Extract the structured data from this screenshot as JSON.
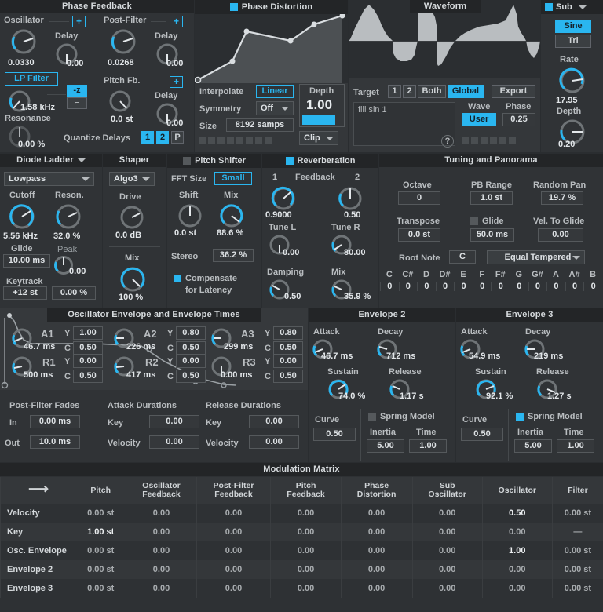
{
  "colors": {
    "accent": "#2ab6f0",
    "panel": "#303336",
    "header": "#232527",
    "text": "#c9cdd0"
  },
  "phase_feedback": {
    "title": "Phase Feedback",
    "oscillator": {
      "label": "Oscillator",
      "value": "0.0330",
      "plus": "+"
    },
    "osc_delay": {
      "label": "Delay",
      "value": "0.00"
    },
    "lp_filter": {
      "label": "LP Filter",
      "value": "1.58 kHz"
    },
    "mode_z": "-z",
    "resonance": {
      "label": "Resonance",
      "value": "0.00 %"
    },
    "post_filter": {
      "label": "Post-Filter",
      "value": "0.0268",
      "plus": "+"
    },
    "post_delay": {
      "label": "Delay",
      "value": "0.00"
    },
    "pitch_fb": {
      "label": "Pitch Fb.",
      "value": "0.0 st",
      "plus": "+"
    },
    "pitch_delay": {
      "label": "Delay",
      "value": "0.00"
    },
    "quantize": {
      "label": "Quantize Delays",
      "b1": "1",
      "b2": "2",
      "bp": "P"
    }
  },
  "phase_distortion": {
    "title": "Phase Distortion",
    "enabled": true,
    "interpolate": {
      "label": "Interpolate",
      "value": "Linear"
    },
    "symmetry": {
      "label": "Symmetry",
      "value": "Off"
    },
    "size": {
      "label": "Size",
      "value": "8192 samps"
    },
    "depth": {
      "label": "Depth",
      "value": "1.00"
    },
    "clip": {
      "value": "Clip"
    },
    "curve_points": [
      [
        0,
        100
      ],
      [
        24,
        72
      ],
      [
        34,
        30
      ],
      [
        62,
        44
      ],
      [
        78,
        18
      ],
      [
        96,
        2
      ]
    ]
  },
  "waveform": {
    "title": "Waveform",
    "target": {
      "label": "Target",
      "b1": "1",
      "b2": "2",
      "both": "Both",
      "global": "Global"
    },
    "export": "Export",
    "script": "fill sin 1",
    "wave": {
      "label": "Wave",
      "value": "User"
    },
    "phase": {
      "label": "Phase",
      "value": "0.25"
    },
    "help": "?"
  },
  "sub": {
    "title": "Sub",
    "enabled": true,
    "sine": "Sine",
    "tri": "Tri",
    "rate": {
      "label": "Rate",
      "value": "17.95"
    },
    "depth": {
      "label": "Depth",
      "value": "0.20"
    }
  },
  "filter": {
    "title": "Diode Ladder",
    "mode": "Lowpass",
    "cutoff": {
      "label": "Cutoff",
      "value": "5.56 kHz"
    },
    "reson": {
      "label": "Reson.",
      "value": "32.0 %"
    },
    "glide": {
      "label": "Glide",
      "value": "10.00 ms"
    },
    "peak": {
      "label": "Peak",
      "value": "0.00"
    },
    "keytrack": {
      "label": "Keytrack",
      "value": "+12 st",
      "value2": "0.00 %"
    }
  },
  "shaper": {
    "title": "Shaper",
    "algo": "Algo3",
    "drive": {
      "label": "Drive",
      "value": "0.0 dB"
    },
    "mix": {
      "label": "Mix",
      "value": "100 %"
    }
  },
  "pitch_shifter": {
    "title": "Pitch Shifter",
    "enabled": false,
    "fft_size": {
      "label": "FFT Size",
      "value": "Small"
    },
    "shift": {
      "label": "Shift",
      "value": "0.0 st"
    },
    "mix": {
      "label": "Mix",
      "value": "88.6 %"
    },
    "stereo": {
      "label": "Stereo",
      "value": "36.2 %"
    },
    "compensate": {
      "line1": "Compensate",
      "line2": "for Latency",
      "enabled": true
    }
  },
  "reverb": {
    "title": "Reverberation",
    "enabled": true,
    "feedback_label": "Feedback",
    "fb1": {
      "label": "1",
      "value": "0.9000"
    },
    "fb2": {
      "label": "2",
      "value": "0.50"
    },
    "tune_l": {
      "label": "Tune L",
      "value": "0.00"
    },
    "tune_r": {
      "label": "Tune R",
      "value": "80.00"
    },
    "damping": {
      "label": "Damping",
      "value": "0.50"
    },
    "mix": {
      "label": "Mix",
      "value": "35.9 %"
    }
  },
  "tuning": {
    "title": "Tuning and Panorama",
    "octave": {
      "label": "Octave",
      "value": "0"
    },
    "pb_range": {
      "label": "PB Range",
      "value": "1.0 st"
    },
    "random_pan": {
      "label": "Random Pan",
      "value": "19.7 %"
    },
    "transpose": {
      "label": "Transpose",
      "value": "0.0 st"
    },
    "glide": {
      "label": "Glide",
      "value": "50.0 ms",
      "enabled": false
    },
    "vel_to_glide": {
      "label": "Vel. To Glide",
      "value": "0.00"
    },
    "root_note": {
      "label": "Root Note",
      "value": "C"
    },
    "temperament": "Equal Tempered",
    "notes": [
      "C",
      "C#",
      "D",
      "D#",
      "E",
      "F",
      "F#",
      "G",
      "G#",
      "A",
      "A#",
      "B"
    ],
    "note_values": [
      "0",
      "0",
      "0",
      "0",
      "0",
      "0",
      "0",
      "0",
      "0",
      "0",
      "0",
      "0"
    ]
  },
  "osc_envelope": {
    "title": "Oscillator Envelope and Envelope Times",
    "stages": [
      {
        "name": "A1",
        "time": "46.7 ms",
        "y": "1.00",
        "c": "0.50"
      },
      {
        "name": "A2",
        "time": "226 ms",
        "y": "0.80",
        "c": "0.50"
      },
      {
        "name": "A3",
        "time": "299 ms",
        "y": "0.80",
        "c": "0.50"
      },
      {
        "name": "R1",
        "time": "500 ms",
        "y": "0.00",
        "c": "0.50"
      },
      {
        "name": "R2",
        "time": "417 ms",
        "y": "0.00",
        "c": "0.50"
      },
      {
        "name": "R3",
        "time": "0.00 ms",
        "y": "0.00",
        "c": "0.50"
      }
    ],
    "y_label": "Y",
    "c_label": "C",
    "post_filter_fades": {
      "title": "Post-Filter Fades",
      "in_label": "In",
      "in_value": "0.00 ms",
      "out_label": "Out",
      "out_value": "10.0 ms"
    },
    "attack_durations": {
      "title": "Attack Durations",
      "key_label": "Key",
      "key_value": "0.00",
      "vel_label": "Velocity",
      "vel_value": "0.00"
    },
    "release_durations": {
      "title": "Release Durations",
      "key_label": "Key",
      "key_value": "0.00",
      "vel_label": "Velocity",
      "vel_value": "0.00"
    }
  },
  "envelope2": {
    "title": "Envelope 2",
    "attack": {
      "label": "Attack",
      "value": "46.7 ms"
    },
    "decay": {
      "label": "Decay",
      "value": "712 ms"
    },
    "sustain": {
      "label": "Sustain",
      "value": "74.0 %"
    },
    "release": {
      "label": "Release",
      "value": "1.17 s"
    },
    "curve": {
      "label": "Curve",
      "value": "0.50"
    },
    "spring": {
      "label": "Spring Model",
      "enabled": false
    },
    "inertia": {
      "label": "Inertia",
      "value": "5.00"
    },
    "time": {
      "label": "Time",
      "value": "1.00"
    }
  },
  "envelope3": {
    "title": "Envelope 3",
    "attack": {
      "label": "Attack",
      "value": "54.9 ms"
    },
    "decay": {
      "label": "Decay",
      "value": "219 ms"
    },
    "sustain": {
      "label": "Sustain",
      "value": "92.1 %"
    },
    "release": {
      "label": "Release",
      "value": "1.27 s"
    },
    "curve": {
      "label": "Curve",
      "value": "0.50"
    },
    "spring": {
      "label": "Spring Model",
      "enabled": true
    },
    "inertia": {
      "label": "Inertia",
      "value": "5.00"
    },
    "time": {
      "label": "Time",
      "value": "1.00"
    }
  },
  "modulation_matrix": {
    "title": "Modulation Matrix",
    "arrow_icon": "→",
    "columns": [
      "Pitch",
      "Oscillator Feedback",
      "Post-Filter Feedback",
      "Pitch Feedback",
      "Phase Distortion",
      "Sub Oscillator",
      "Oscillator",
      "Filter"
    ],
    "rows": [
      {
        "name": "Velocity",
        "values": [
          "0.00 st",
          "0.00",
          "0.00",
          "0.00",
          "0.00",
          "0.00",
          "0.50",
          "0.00 st"
        ],
        "hi": [
          6
        ]
      },
      {
        "name": "Key",
        "values": [
          "1.00 st",
          "0.00",
          "0.00",
          "0.00",
          "0.00",
          "0.00",
          "0.00",
          "—"
        ],
        "hi": [
          0
        ]
      },
      {
        "name": "Osc. Envelope",
        "values": [
          "0.00 st",
          "0.00",
          "0.00",
          "0.00",
          "0.00",
          "0.00",
          "1.00",
          "0.00 st"
        ],
        "hi": [
          6
        ]
      },
      {
        "name": "Envelope 2",
        "values": [
          "0.00 st",
          "0.00",
          "0.00",
          "0.00",
          "0.00",
          "0.00",
          "0.00",
          "0.00 st"
        ],
        "hi": []
      },
      {
        "name": "Envelope 3",
        "values": [
          "0.00 st",
          "0.00",
          "0.00",
          "0.00",
          "0.00",
          "0.00",
          "0.00",
          "0.00 st"
        ],
        "hi": []
      }
    ]
  }
}
